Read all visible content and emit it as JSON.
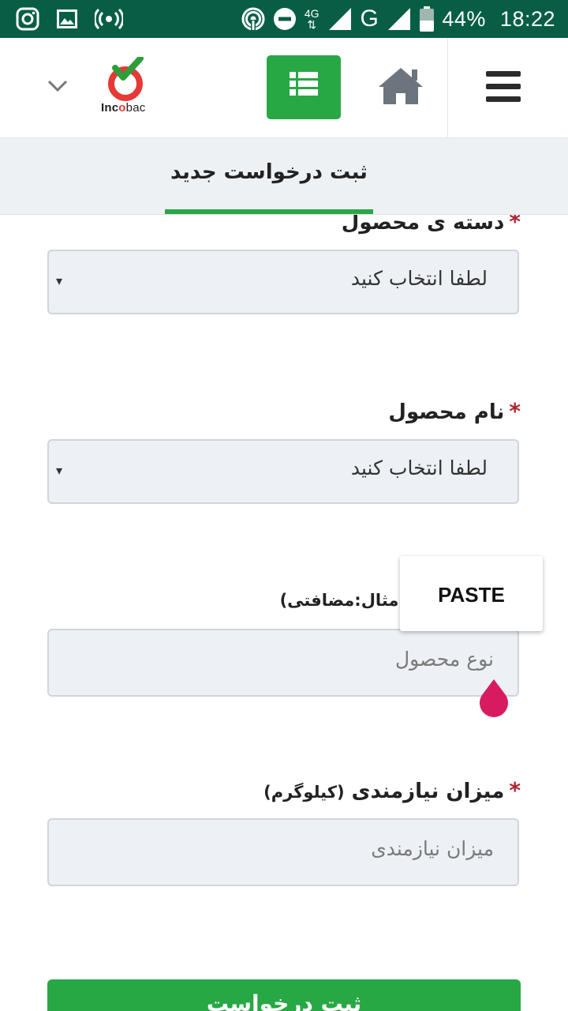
{
  "status_bar": {
    "battery": "44%",
    "time": "18:22",
    "network_type": "4G",
    "network_letter": "G",
    "left_icons": [
      "instagram-icon",
      "image-icon",
      "hotspot-icon"
    ],
    "right_icons": [
      "cast-icon",
      "do-not-disturb-icon",
      "signal-icon",
      "signal-icon",
      "battery-icon"
    ]
  },
  "header": {
    "logo_text_bold": "Inc",
    "logo_text_rest": "bac",
    "menu_icon": "hamburger-icon",
    "home_icon": "home-icon",
    "list_icon": "list-icon",
    "dropdown_icon": "chevron-down-icon"
  },
  "tabs": {
    "active_label": "ثبت درخواست جدید"
  },
  "form": {
    "category": {
      "label": "دسته ی محصول",
      "required": "*",
      "selected": "لطفا انتخاب کنید",
      "caret": "▾"
    },
    "product_name": {
      "label": "نام محصول",
      "required": "*",
      "selected": "لطفا انتخاب کنید",
      "caret": "▾"
    },
    "product_type": {
      "label_partial": "(مثال:مضافتی)",
      "placeholder": "نوع محصول"
    },
    "quantity": {
      "label": "میزان نیازمندی",
      "label_unit": "(کیلوگرم)",
      "required": "*",
      "placeholder": "میزان نیازمندی"
    },
    "submit_label": "ثبت درخواست"
  },
  "context_menu": {
    "paste_label": "PASTE"
  },
  "colors": {
    "status_bar": "#075e45",
    "accent_green": "#28a745",
    "required_red": "#b0242f",
    "handle_pink": "#d81b60"
  }
}
